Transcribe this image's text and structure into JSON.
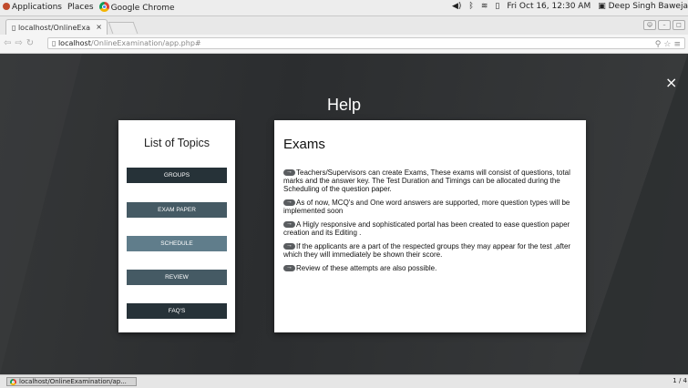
{
  "panel": {
    "applications": "Applications",
    "places": "Places",
    "active_app": "Google Chrome",
    "clock": "Fri Oct 16, 12:30 AM",
    "user": "Deep Singh Baweja"
  },
  "browser": {
    "tab_title": "localhost/OnlineExa",
    "address_host": "localhost",
    "address_path": "/OnlineExamination/app.php#"
  },
  "modal": {
    "close": "×",
    "title": "Help"
  },
  "topics": {
    "heading": "List of Topics",
    "items": [
      {
        "label": "GROUPS",
        "color": "#263238"
      },
      {
        "label": "EXAM PAPER",
        "color": "#455a64"
      },
      {
        "label": "SCHEDULE",
        "color": "#607d8b"
      },
      {
        "label": "REVIEW",
        "color": "#455a64"
      },
      {
        "label": "FAQ'S",
        "color": "#263238"
      }
    ]
  },
  "content": {
    "heading": "Exams",
    "paragraphs": [
      "Teachers/Supervisors can create Exams, These exams will consist of questions, total marks and the answer key. The Test Duration and Timings can be allocated during the Scheduling of the question paper.",
      "As of now, MCQ's and One word answers are supported, more question types will be implemented soon",
      "A Higly responsive and sophisticated portal has been created to ease question paper creation and its Editing .",
      "If the applicants are a part of the respected groups they may appear for the test ,after which they will immediately be shown their score.",
      "Review of these attempts are also possible."
    ]
  },
  "statusbar": {
    "task": "localhost/OnlineExamination/ap...",
    "pager": "1 / 4"
  }
}
